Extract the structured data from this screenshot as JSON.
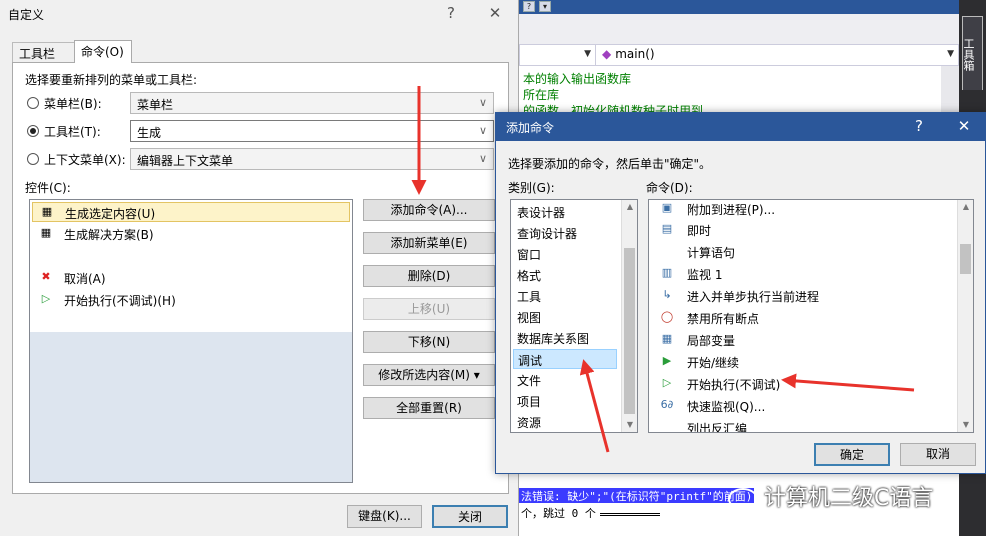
{
  "ide": {
    "function_combo": "main()",
    "code_lines": [
      "本的输入输出函数库",
      "所在库",
      "的函数，初始化随机数种子时用到"
    ],
    "error_line": "法错误: 缺少\";\"(在标识符\"printf\"的前面)",
    "skip_line": "个，跳过 0 个",
    "sidebar_tab": "工具箱"
  },
  "customize": {
    "title": "自定义",
    "help_glyph": "?",
    "close_glyph": "✕",
    "tabs": [
      "工具栏(S)",
      "命令(O)"
    ],
    "prompt": "选择要重新排列的菜单或工具栏:",
    "radio_options": [
      {
        "label": "菜单栏(B):",
        "value": "菜单栏",
        "selected": false
      },
      {
        "label": "工具栏(T):",
        "value": "生成",
        "selected": true
      },
      {
        "label": "上下文菜单(X):",
        "value": "编辑器上下文菜单",
        "selected": false
      }
    ],
    "controls_label": "控件(C):",
    "controls": [
      {
        "label": "生成选定内容(U)",
        "icon": "build-selection-icon",
        "selected": true
      },
      {
        "label": "生成解决方案(B)",
        "icon": "build-solution-icon",
        "selected": false
      },
      {
        "label": "取消(A)",
        "icon": "cancel-build-icon",
        "selected": false
      },
      {
        "label": "开始执行(不调试)(H)",
        "icon": "start-without-debug-icon",
        "selected": false
      }
    ],
    "buttons": [
      "添加命令(A)...",
      "添加新菜单(E)",
      "删除(D)",
      "上移(U)",
      "下移(N)",
      "修改所选内容(M) ▾",
      "全部重置(R)"
    ],
    "footer": {
      "keyboard": "键盘(K)...",
      "close": "关闭"
    }
  },
  "add_command": {
    "title": "添加命令",
    "help_glyph": "?",
    "close_glyph": "✕",
    "instruction": "选择要添加的命令，然后单击\"确定\"。",
    "category_label": "类别(G):",
    "command_label": "命令(D):",
    "categories": [
      "表设计器",
      "查询设计器",
      "窗口",
      "格式",
      "工具",
      "视图",
      "数据库关系图",
      "调试",
      "文件",
      "项目",
      "资源"
    ],
    "selected_category": "调试",
    "commands": [
      {
        "label": "附加到进程(P)...",
        "icon": "attach-process-icon"
      },
      {
        "label": "即时",
        "icon": "immediate-window-icon"
      },
      {
        "label": "计算语句",
        "icon": ""
      },
      {
        "label": "监视 1",
        "icon": "watch-icon"
      },
      {
        "label": "进入并单步执行当前进程",
        "icon": "step-into-icon"
      },
      {
        "label": "禁用所有断点",
        "icon": "disable-breakpoints-icon"
      },
      {
        "label": "局部变量",
        "icon": "locals-icon"
      },
      {
        "label": "开始/继续",
        "icon": "start-continue-icon"
      },
      {
        "label": "开始执行(不调试)",
        "icon": "start-without-debug-icon"
      },
      {
        "label": "快速监视(Q)...",
        "icon": "quick-watch-icon"
      },
      {
        "label": "列出反汇编",
        "icon": ""
      }
    ],
    "ok": "确定",
    "cancel": "取消"
  },
  "watermark": "计算机二级C语言",
  "colors": {
    "accent": "#2b579a",
    "arrow": "#e8322b",
    "selection": "#cce8ff",
    "highlight": "#fdf3c9"
  }
}
